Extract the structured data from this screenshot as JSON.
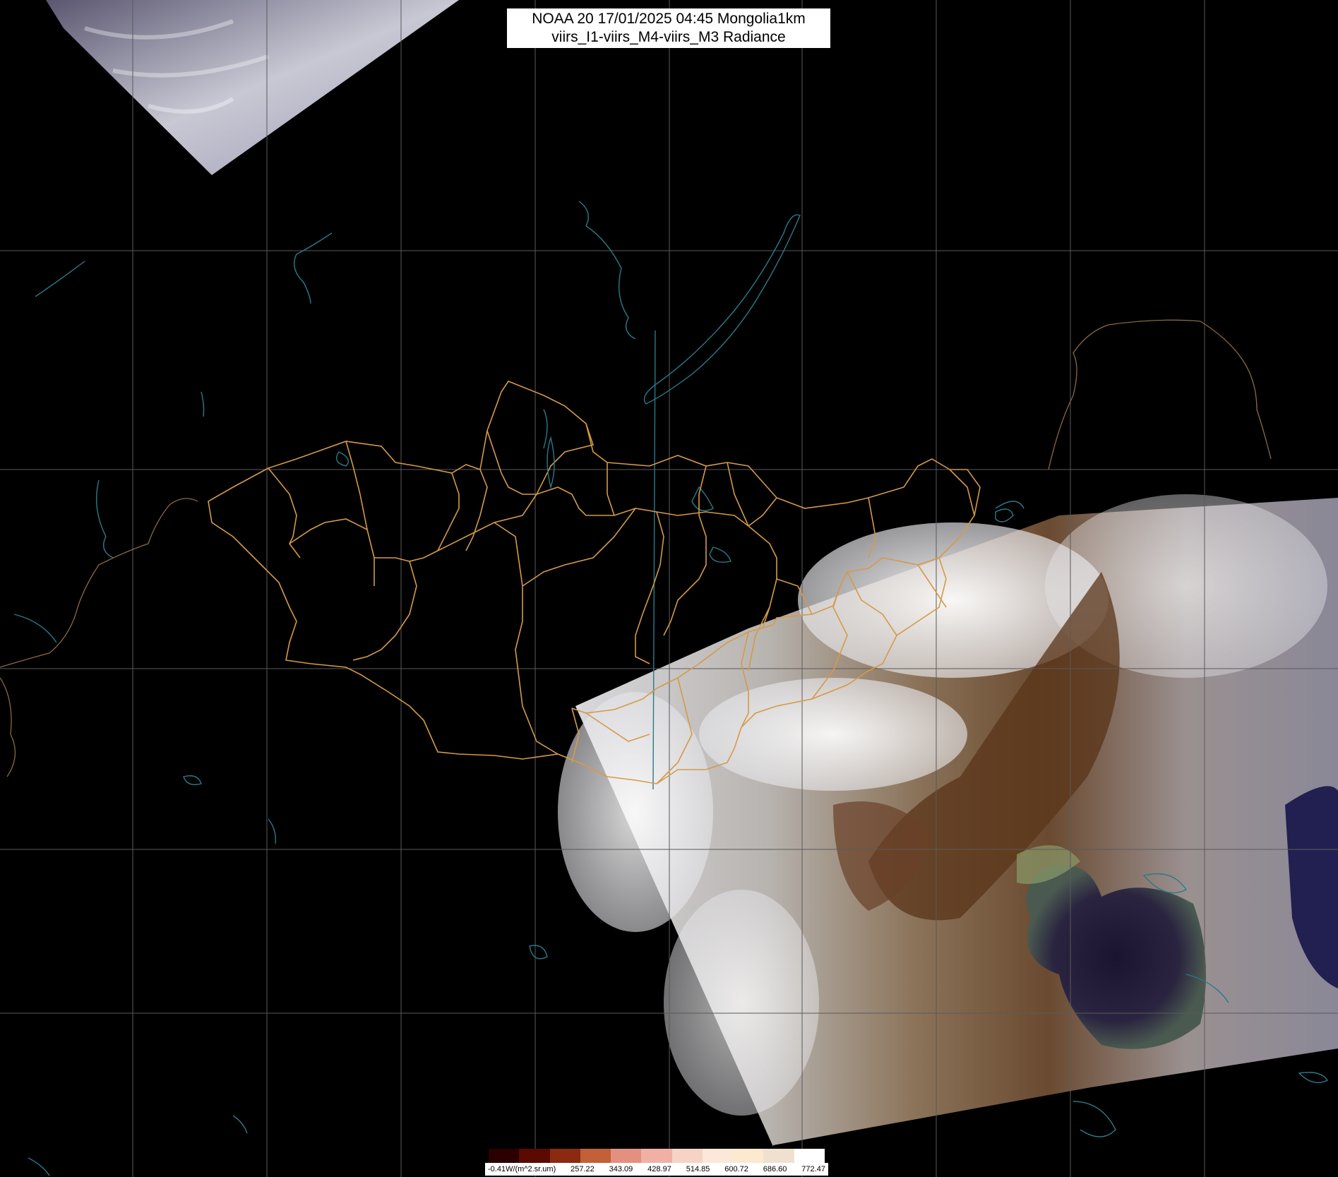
{
  "title": {
    "line1": "NOAA 20 17/01/2025 04:45 Mongolia1km",
    "line2": "viirs_I1-viirs_M4-viirs_M3 Radiance"
  },
  "legend": {
    "labels": [
      "-0.41W/(m^2.sr.um)",
      "257.22",
      "343.09",
      "428.97",
      "514.85",
      "600.72",
      "686.60",
      "772.47"
    ],
    "colors": [
      "#2a0000",
      "#5a0a00",
      "#8a2a10",
      "#c2603a",
      "#e49080",
      "#f0b0a6",
      "#f7d2c6",
      "#fbe8d8",
      "#fde8d0",
      "#f0e0d0",
      "#ffffff"
    ]
  },
  "colors": {
    "background": "#000000",
    "grid": "#5a5a5a",
    "borders": "#d49a4a",
    "water": "#2a7a8a",
    "swath_snow": "#e8e8ec",
    "swath_land": "#8a6a48",
    "swath_sea": "#241e3c"
  }
}
